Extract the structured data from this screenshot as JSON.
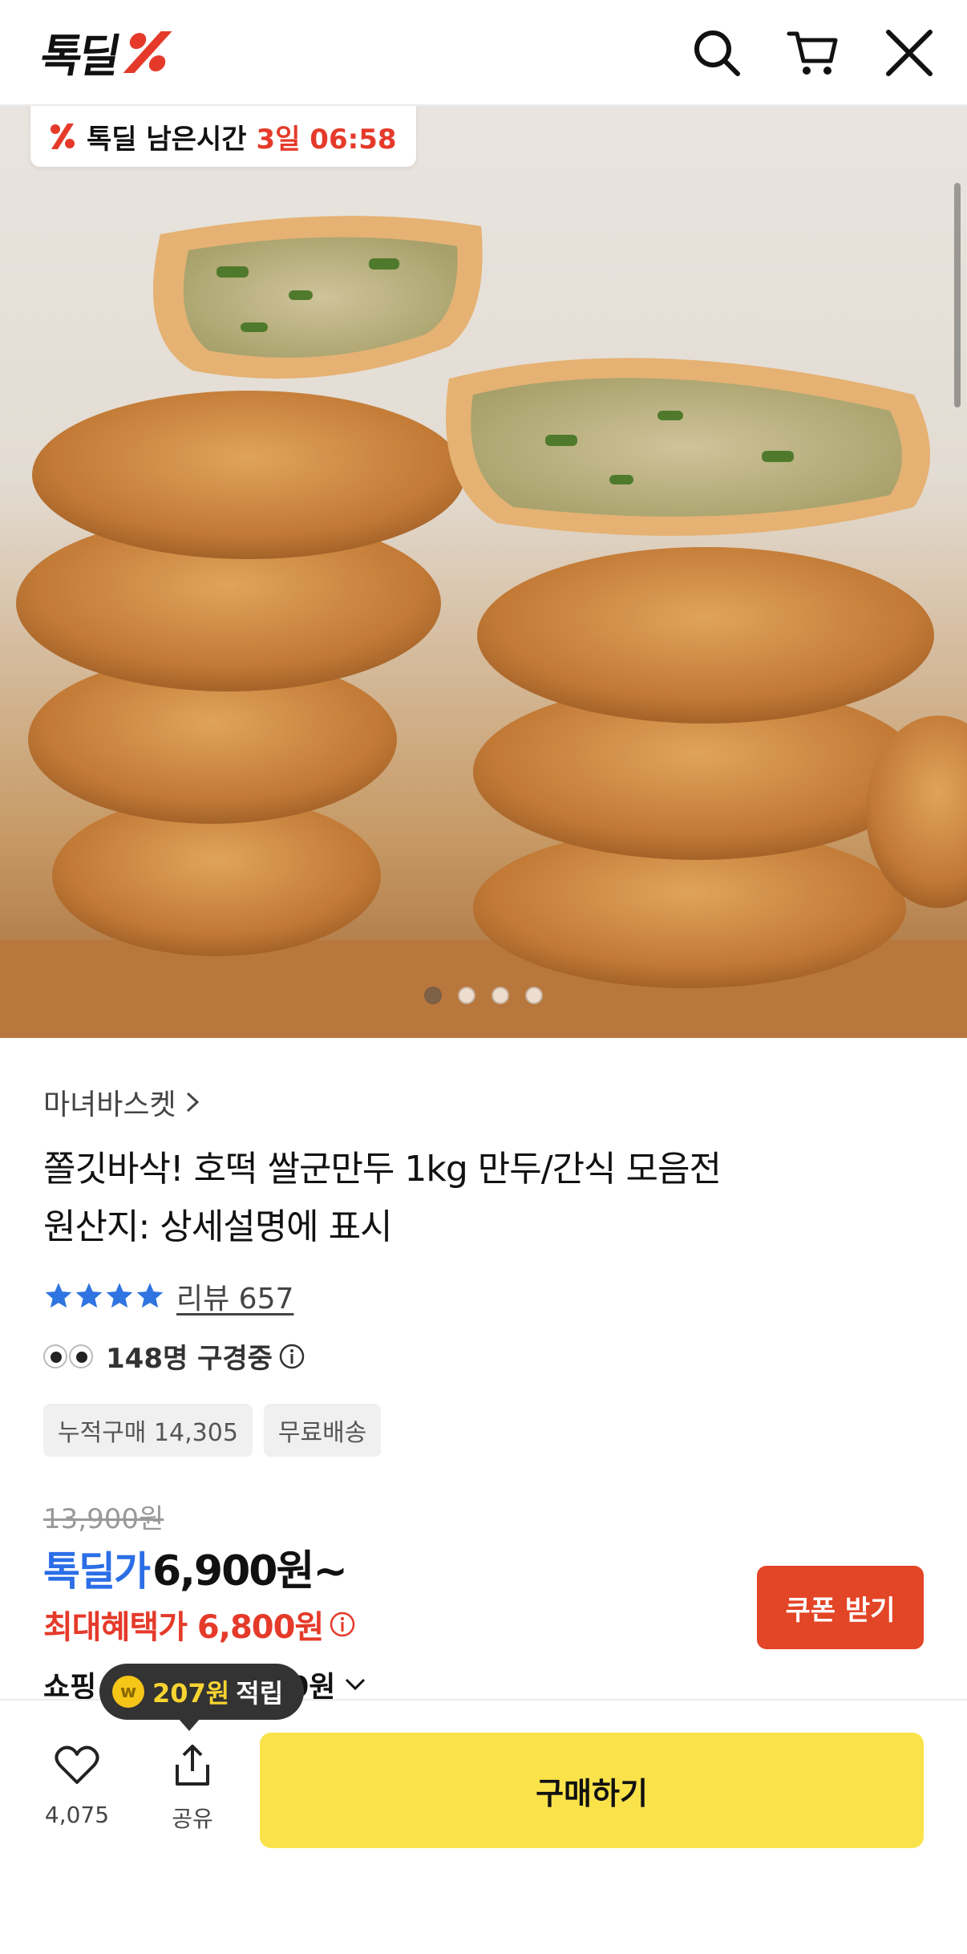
{
  "header": {
    "logo_text": "톡딜",
    "icons": [
      "search-icon",
      "cart-icon",
      "close-icon"
    ]
  },
  "hero": {
    "timer_label": "톡딜 남은시간",
    "timer_value": "3일 06:58",
    "image_count": 4,
    "active_index": 0
  },
  "product": {
    "seller": "마녀바스켓",
    "title_line1": "쫄깃바삭! 호떡 쌀군만두 1kg 만두/간식 모음전",
    "title_line2": "원산지: 상세설명에 표시",
    "rating_stars": 4,
    "review_label": "리뷰 657",
    "viewing_text": "148명 구경중",
    "tags": [
      "누적구매 14,305",
      "무료배송"
    ]
  },
  "price": {
    "original": "13,900원",
    "deal_label": "톡딜가",
    "deal_price": "6,900원~",
    "max_benefit": "최대혜택가 6,800원",
    "coupon_button": "쿠폰 받기",
    "shopping_prefix": "쇼핑",
    "shopping_suffix": "0원"
  },
  "tooltip": {
    "points": "207원",
    "text": "적립"
  },
  "bottom_bar": {
    "like_count": "4,075",
    "share_label": "공유",
    "buy_button": "구매하기"
  },
  "colors": {
    "accent_red": "#e53a2a",
    "deal_blue": "#2b6ee6",
    "buy_yellow": "#fae34a",
    "coupon_red": "#e34527"
  }
}
